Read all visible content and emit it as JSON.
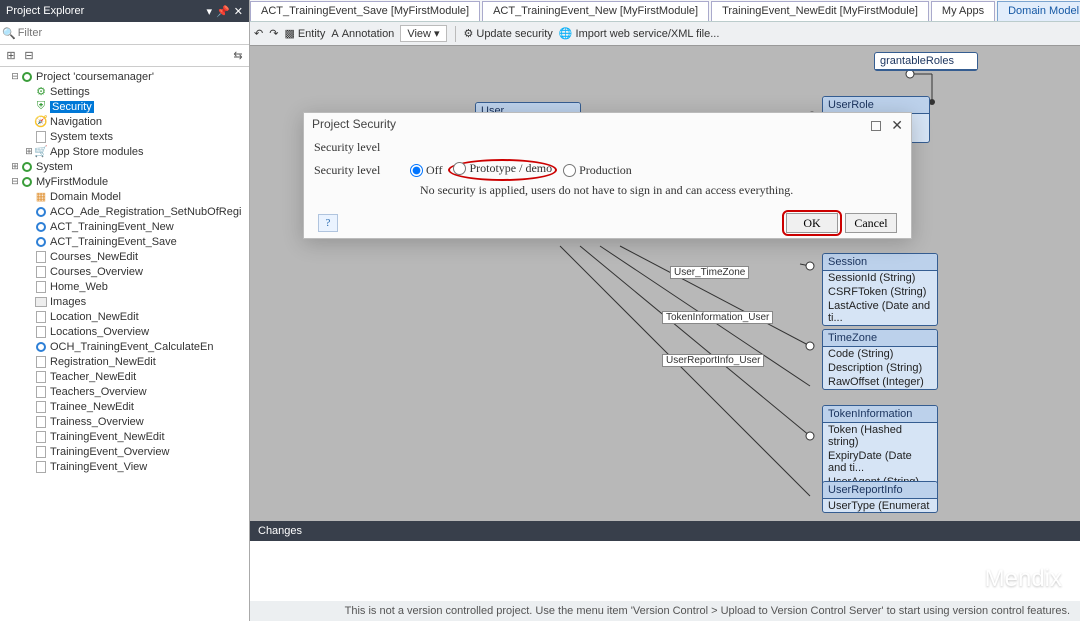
{
  "panel": {
    "title": "Project Explorer",
    "filter_placeholder": "Filter"
  },
  "tree": [
    {
      "lvl": 1,
      "exp": "⊟",
      "ico": "circle-green",
      "label": "Project 'coursemanager'"
    },
    {
      "lvl": 2,
      "exp": "",
      "ico": "gear",
      "label": "Settings"
    },
    {
      "lvl": 2,
      "exp": "",
      "ico": "shield",
      "label": "Security",
      "sel": true
    },
    {
      "lvl": 2,
      "exp": "",
      "ico": "compass",
      "label": "Navigation"
    },
    {
      "lvl": 2,
      "exp": "",
      "ico": "file",
      "label": "System texts"
    },
    {
      "lvl": 2,
      "exp": "⊞",
      "ico": "cart",
      "label": "App Store modules"
    },
    {
      "lvl": 1,
      "exp": "⊞",
      "ico": "circle-green",
      "label": "System"
    },
    {
      "lvl": 1,
      "exp": "⊟",
      "ico": "circle-green",
      "label": "MyFirstModule"
    },
    {
      "lvl": 2,
      "exp": "",
      "ico": "domain",
      "label": "Domain Model"
    },
    {
      "lvl": 2,
      "exp": "",
      "ico": "circle-blue",
      "label": "ACO_Ade_Registration_SetNubOfRegi"
    },
    {
      "lvl": 2,
      "exp": "",
      "ico": "circle-blue",
      "label": "ACT_TrainingEvent_New"
    },
    {
      "lvl": 2,
      "exp": "",
      "ico": "circle-blue",
      "label": "ACT_TrainingEvent_Save"
    },
    {
      "lvl": 2,
      "exp": "",
      "ico": "file",
      "label": "Courses_NewEdit"
    },
    {
      "lvl": 2,
      "exp": "",
      "ico": "file",
      "label": "Courses_Overview"
    },
    {
      "lvl": 2,
      "exp": "",
      "ico": "file",
      "label": "Home_Web"
    },
    {
      "lvl": 2,
      "exp": "",
      "ico": "stack",
      "label": "Images"
    },
    {
      "lvl": 2,
      "exp": "",
      "ico": "file",
      "label": "Location_NewEdit"
    },
    {
      "lvl": 2,
      "exp": "",
      "ico": "file",
      "label": "Locations_Overview"
    },
    {
      "lvl": 2,
      "exp": "",
      "ico": "circle-blue",
      "label": "OCH_TrainingEvent_CalculateEn"
    },
    {
      "lvl": 2,
      "exp": "",
      "ico": "file",
      "label": "Registration_NewEdit"
    },
    {
      "lvl": 2,
      "exp": "",
      "ico": "file",
      "label": "Teacher_NewEdit"
    },
    {
      "lvl": 2,
      "exp": "",
      "ico": "file",
      "label": "Teachers_Overview"
    },
    {
      "lvl": 2,
      "exp": "",
      "ico": "file",
      "label": "Trainee_NewEdit"
    },
    {
      "lvl": 2,
      "exp": "",
      "ico": "file",
      "label": "Trainess_Overview"
    },
    {
      "lvl": 2,
      "exp": "",
      "ico": "file",
      "label": "TrainingEvent_NewEdit"
    },
    {
      "lvl": 2,
      "exp": "",
      "ico": "file",
      "label": "TrainingEvent_Overview"
    },
    {
      "lvl": 2,
      "exp": "",
      "ico": "file",
      "label": "TrainingEvent_View"
    }
  ],
  "tabs": [
    {
      "label": "ACT_TrainingEvent_Save [MyFirstModule]"
    },
    {
      "label": "ACT_TrainingEvent_New [MyFirstModule]"
    },
    {
      "label": "TrainingEvent_NewEdit [MyFirstModule]"
    },
    {
      "label": "My Apps"
    },
    {
      "label": "Domain Model [System]",
      "active": true
    }
  ],
  "subtoolbar": {
    "entity": "Entity",
    "annotation": "Annotation",
    "view": "View",
    "update": "Update security",
    "import": "Import web service/XML file..."
  },
  "entities": {
    "user": {
      "title": "User"
    },
    "userrole": {
      "title": "UserRole",
      "rows": [
        "g)",
        "g)"
      ]
    },
    "session": {
      "title": "Session",
      "rows": [
        "SessionId (String)",
        "CSRFToken (String)",
        "LastActive (Date and ti..."
      ]
    },
    "timezone": {
      "title": "TimeZone",
      "rows": [
        "Code (String)",
        "Description (String)",
        "RawOffset (Integer)"
      ]
    },
    "tokeninfo": {
      "title": "TokenInformation",
      "rows": [
        "Token (Hashed string)",
        "ExpiryDate (Date and ti...",
        "UserAgent (String)"
      ]
    },
    "userreport": {
      "title": "UserReportInfo",
      "rows": [
        "UserType (Enumerat"
      ]
    },
    "grantable": {
      "title": "grantableRoles"
    }
  },
  "assoc": {
    "user_timezone": "User_TimeZone",
    "token_user": "TokenInformation_User",
    "userreport_user": "UserReportInfo_User"
  },
  "dialog": {
    "title": "Project Security",
    "heading": "Security level",
    "label": "Security level",
    "opt_off": "Off",
    "opt_proto": "Prototype / demo",
    "opt_prod": "Production",
    "hint": "No security is applied, users do not have to sign in and can access everything.",
    "ok": "OK",
    "cancel": "Cancel"
  },
  "changes": {
    "title": "Changes"
  },
  "statusbar": "This is not a version controlled project. Use the menu item 'Version Control > Upload to Version Control Server' to start using version control features.",
  "watermark": "Mendix"
}
